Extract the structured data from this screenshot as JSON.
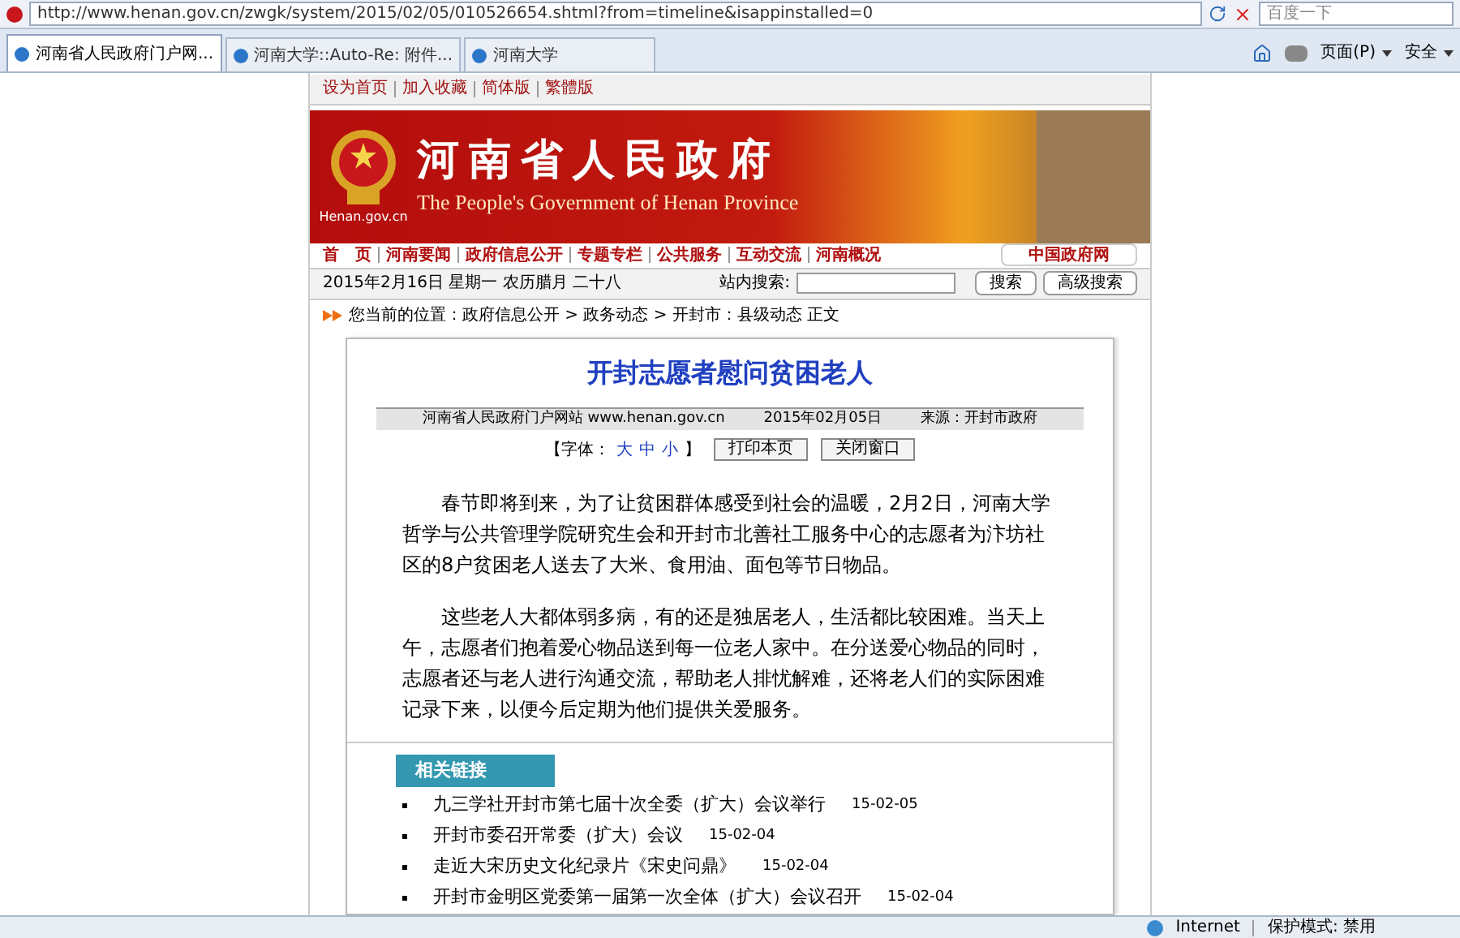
{
  "browser": {
    "url": "http://www.henan.gov.cn/zwgk/system/2015/02/05/010526654.shtml?from=timeline&isappinstalled=0",
    "search_placeholder": "百度一下",
    "tabs": [
      {
        "title": "河南省人民政府门户网...",
        "selected": true
      },
      {
        "title": "河南大学::Auto-Re: 附件...",
        "selected": false
      },
      {
        "title": "河南大学",
        "selected": false
      }
    ],
    "menu_items": [
      "页面(P)",
      "安全"
    ]
  },
  "top_links": [
    "设为首页",
    "加入收藏",
    "简体版",
    "繁體版"
  ],
  "banner": {
    "title": "河南省人民政府",
    "subtitle": "The People's Government of Henan Province",
    "site": "Henan.gov.cn"
  },
  "nav": {
    "items": [
      "首　页",
      "河南要闻",
      "政府信息公开",
      "专题专栏",
      "公共服务",
      "互动交流",
      "河南概况"
    ],
    "button": "中国政府网"
  },
  "date_bar": {
    "date": "2015年2月16日 星期一 农历腊月 二十八",
    "search_label": "站内搜索:",
    "search_button": "搜索",
    "advanced_button": "高级搜索"
  },
  "breadcrumb": "您当前的位置：政府信息公开 > 政务动态 > 开封市：县级动态 正文",
  "article": {
    "title": "开封志愿者慰问贫困老人",
    "meta": [
      "河南省人民政府门户网站 www.henan.gov.cn",
      "2015年02月05日",
      "来源：开封市政府"
    ],
    "font_size": {
      "prefix": "【字体：",
      "options": [
        "大",
        "中",
        "小"
      ],
      "suffix": "】"
    },
    "buttons": [
      "打印本页",
      "关闭窗口"
    ],
    "paragraphs": [
      "春节即将到来，为了让贫困群体感受到社会的温暖，2月2日，河南大学哲学与公共管理学院研究生会和开封市北善社工服务中心的志愿者为汴坊社区的8户贫困老人送去了大米、食用油、面包等节日物品。",
      "这些老人大都体弱多病，有的还是独居老人，生活都比较困难。当天上午，志愿者们抱着爱心物品送到每一位老人家中。在分送爱心物品的同时，志愿者还与老人进行沟通交流，帮助老人排忧解难，还将老人们的实际困难记录下来，以便今后定期为他们提供关爱服务。"
    ]
  },
  "related": {
    "heading": "相关链接",
    "items": [
      {
        "title": "九三学社开封市第七届十次全委（扩大）会议举行",
        "date": "15-02-05"
      },
      {
        "title": "开封市委召开常委（扩大）会议",
        "date": "15-02-04"
      },
      {
        "title": "走近大宋历史文化纪录片《宋史问鼎》",
        "date": "15-02-04"
      },
      {
        "title": "开封市金明区党委第一届第一次全体（扩大）会议召开",
        "date": "15-02-04"
      }
    ]
  },
  "status_bar": {
    "zone": "Internet",
    "protected_mode": "保护模式: 禁用"
  }
}
